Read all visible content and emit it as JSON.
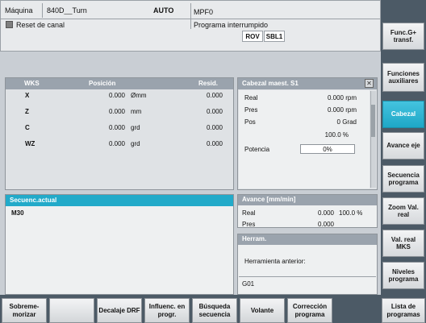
{
  "header": {
    "machine_label": "Máquina",
    "machine_name": "840D__Turn",
    "mode": "AUTO",
    "program": "MPF0",
    "reset_text": "Reset de canal",
    "program_status": "Programa interrumpido",
    "status_flags": [
      "ROV",
      "SBL1"
    ]
  },
  "axes": {
    "columns": [
      "WKS",
      "Posición",
      "Resid."
    ],
    "rows": [
      {
        "axis": "X",
        "pos": "0.000",
        "unit": "Ømm",
        "resid": "0.000"
      },
      {
        "axis": "Z",
        "pos": "0.000",
        "unit": "mm",
        "resid": "0.000"
      },
      {
        "axis": "C",
        "pos": "0.000",
        "unit": "grd",
        "resid": "0.000"
      },
      {
        "axis": "WZ",
        "pos": "0.000",
        "unit": "grd",
        "resid": "0.000"
      }
    ]
  },
  "spindle": {
    "title": "Cabezal maest.  S1",
    "real_label": "Real",
    "real_value": "0.000 rpm",
    "pres_label": "Pres",
    "pres_value": "0.000 rpm",
    "pos_label": "Pos",
    "pos_value": "0 Grad",
    "percent": "100.0 %",
    "power_label": "Potencia",
    "power_value": "0%"
  },
  "sequence": {
    "title": "Secuenc.actual",
    "line": "M30"
  },
  "feed": {
    "title": "Avance [mm/min]",
    "real_label": "Real",
    "real_value": "0.000",
    "real_pct": "100.0 %",
    "pres_label": "Pres",
    "pres_value": "0.000"
  },
  "tool": {
    "title": "Herram.",
    "prev_label": "Herramienta anterior:",
    "gcode": "G01"
  },
  "right_softkeys": [
    {
      "label": "Func.G+ transf.",
      "active": false
    },
    {
      "label": "Funciones auxiliares",
      "active": false
    },
    {
      "label": "Cabezal",
      "active": true
    },
    {
      "label": "Avance eje",
      "active": false
    },
    {
      "label": "Secuencia programa",
      "active": false
    },
    {
      "label": "Zoom Val. real",
      "active": false
    },
    {
      "label": "Val. real MKS",
      "active": false
    },
    {
      "label": "Niveles programa",
      "active": false
    }
  ],
  "bottom_softkeys": [
    "Sobreme- morizar",
    "",
    "Decalaje DRF",
    "Influenc. en progr.",
    "Búsqueda secuencia",
    "Volante",
    "Corrección programa",
    "Lista de programas"
  ],
  "etc_arrow": ">",
  "colors": {
    "accent": "#22aac9",
    "panel_head": "#9aa3ad"
  }
}
